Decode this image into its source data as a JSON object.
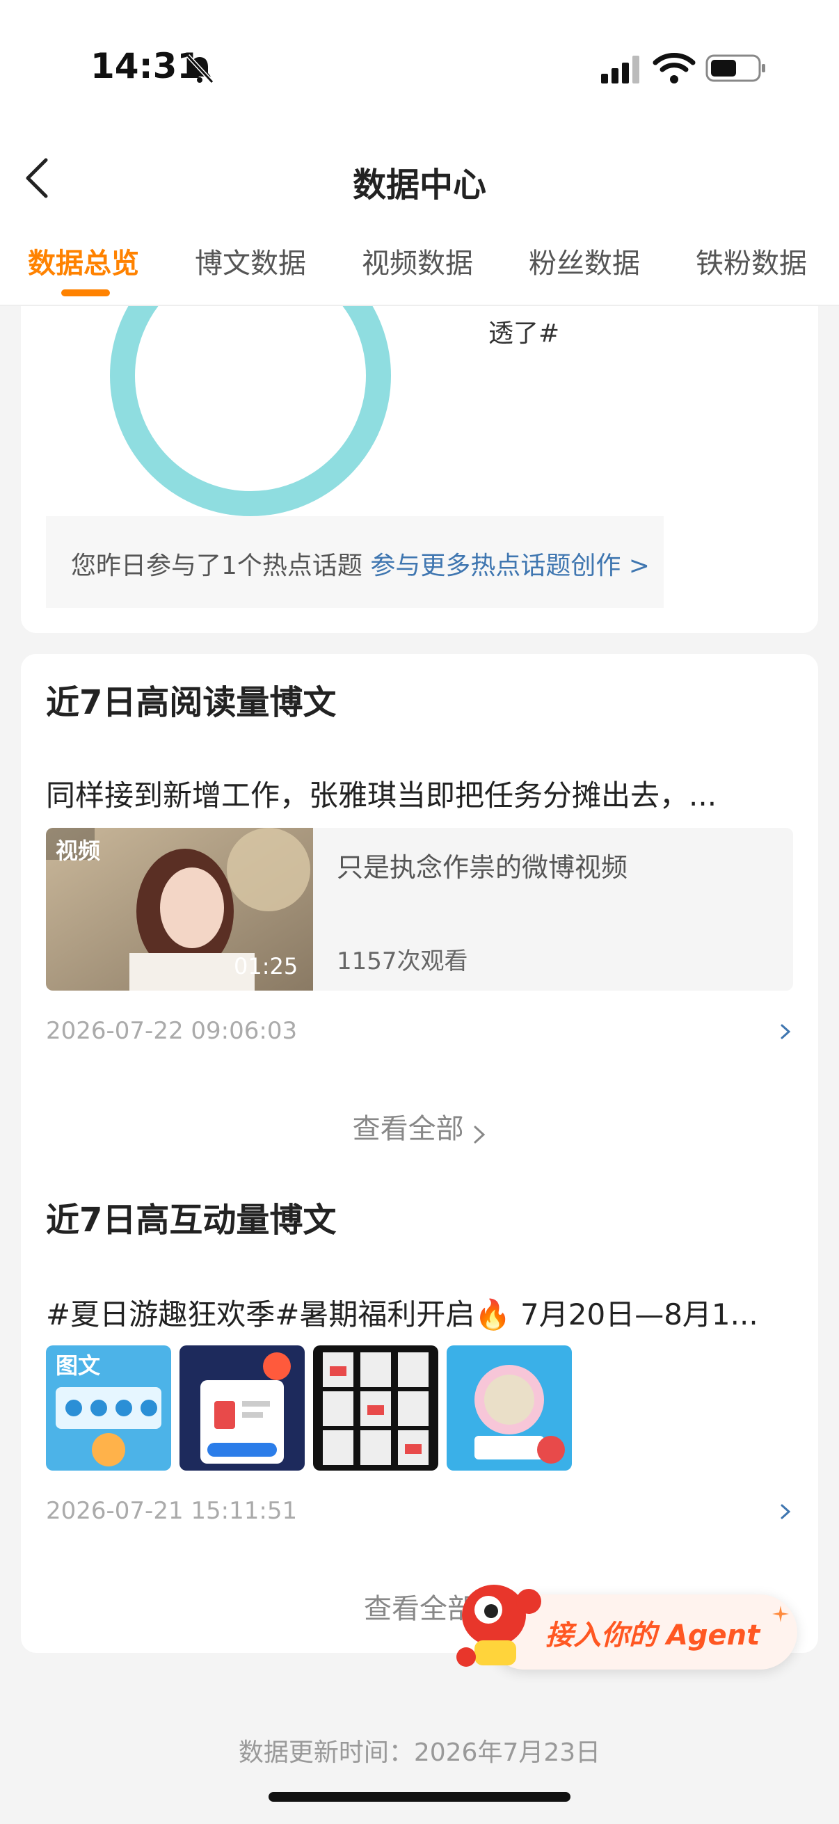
{
  "status": {
    "time": "14:31"
  },
  "nav": {
    "title": "数据中心"
  },
  "tabs": [
    "数据总览",
    "博文数据",
    "视频数据",
    "粉丝数据",
    "铁粉数据"
  ],
  "topic_card": {
    "label_fragment": "透了#",
    "hot_text": "您昨日参与了1个热点话题",
    "hot_link": "参与更多热点话题创作 >"
  },
  "high_read": {
    "title": "近7日高阅读量博文",
    "post_title": "同样接到新增工作，张雅琪当即把任务分摊出去，...",
    "video_tag": "视频",
    "duration": "01:25",
    "video_title": "只是执念作祟的微博视频",
    "views": "1157次观看",
    "date": "2026-07-22 09:06:03",
    "view_all": "查看全部"
  },
  "high_interact": {
    "title": "近7日高互动量博文",
    "post_title": "#夏日游趣狂欢季#暑期福利开启🔥 7月20日—8月1...",
    "image_tag": "图文",
    "date": "2026-07-21 15:11:51",
    "view_all": "查看全部"
  },
  "agent": {
    "label": "接入你的 Agent"
  },
  "footer": {
    "update": "数据更新时间：2026年7月23日"
  },
  "colors": {
    "accent": "#ff8200",
    "link": "#3f76b0",
    "ring": "#8fdde0"
  }
}
